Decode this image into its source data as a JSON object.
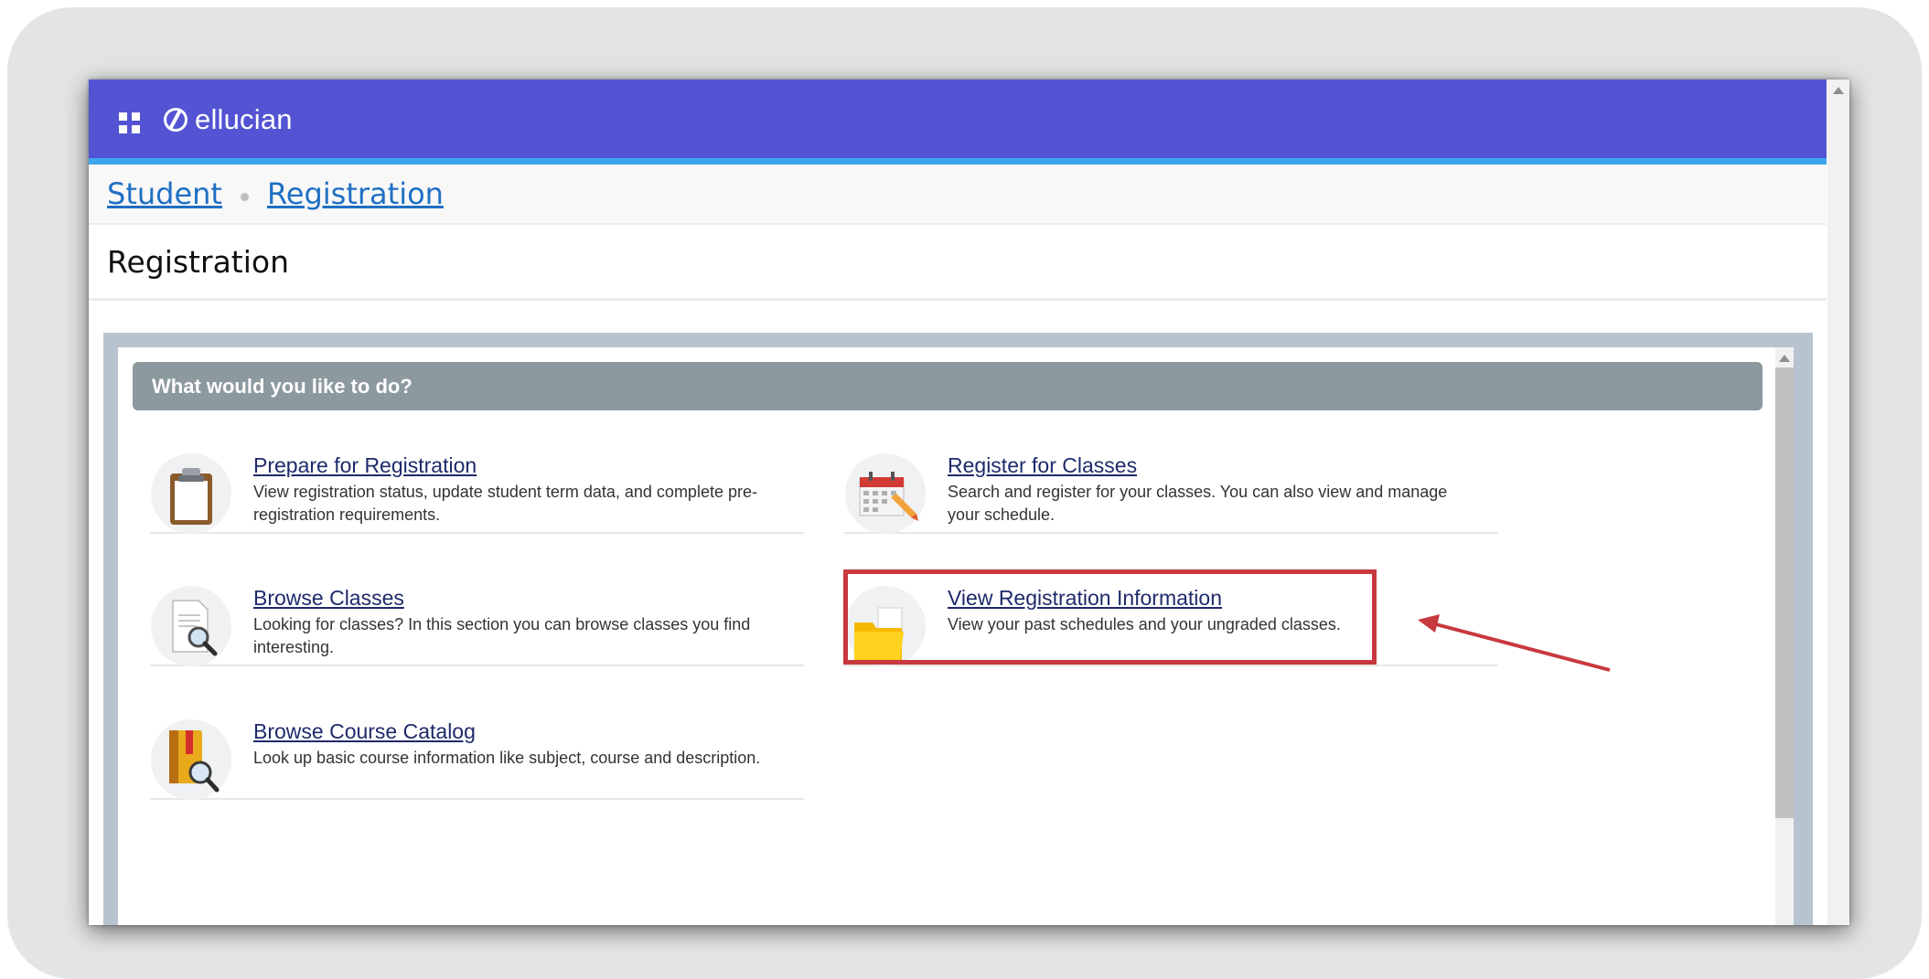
{
  "app": {
    "brand": "ellucian"
  },
  "breadcrumb": {
    "items": [
      "Student",
      "Registration"
    ]
  },
  "page": {
    "title": "Registration"
  },
  "panel": {
    "heading": "What would you like to do?",
    "actions": [
      {
        "title": "Prepare for Registration",
        "description": "View registration status, update student term data, and complete pre-registration requirements.",
        "icon": "clipboard-icon"
      },
      {
        "title": "Register for Classes",
        "description": "Search and register for your classes. You can also view and manage your schedule.",
        "icon": "calendar-pencil-icon"
      },
      {
        "title": "Browse Classes",
        "description": "Looking for classes? In this section you can browse classes you find interesting.",
        "icon": "document-search-icon"
      },
      {
        "title": "View Registration Information",
        "description": "View your past schedules and your ungraded classes.",
        "icon": "folder-icon"
      },
      {
        "title": "Browse Course Catalog",
        "description": "Look up basic course information like subject, course and description.",
        "icon": "book-search-icon"
      }
    ]
  },
  "colors": {
    "header": "#5353d3",
    "header_underline": "#3ea6ef",
    "link": "#1e2a6b",
    "annotation": "#c8383f"
  }
}
